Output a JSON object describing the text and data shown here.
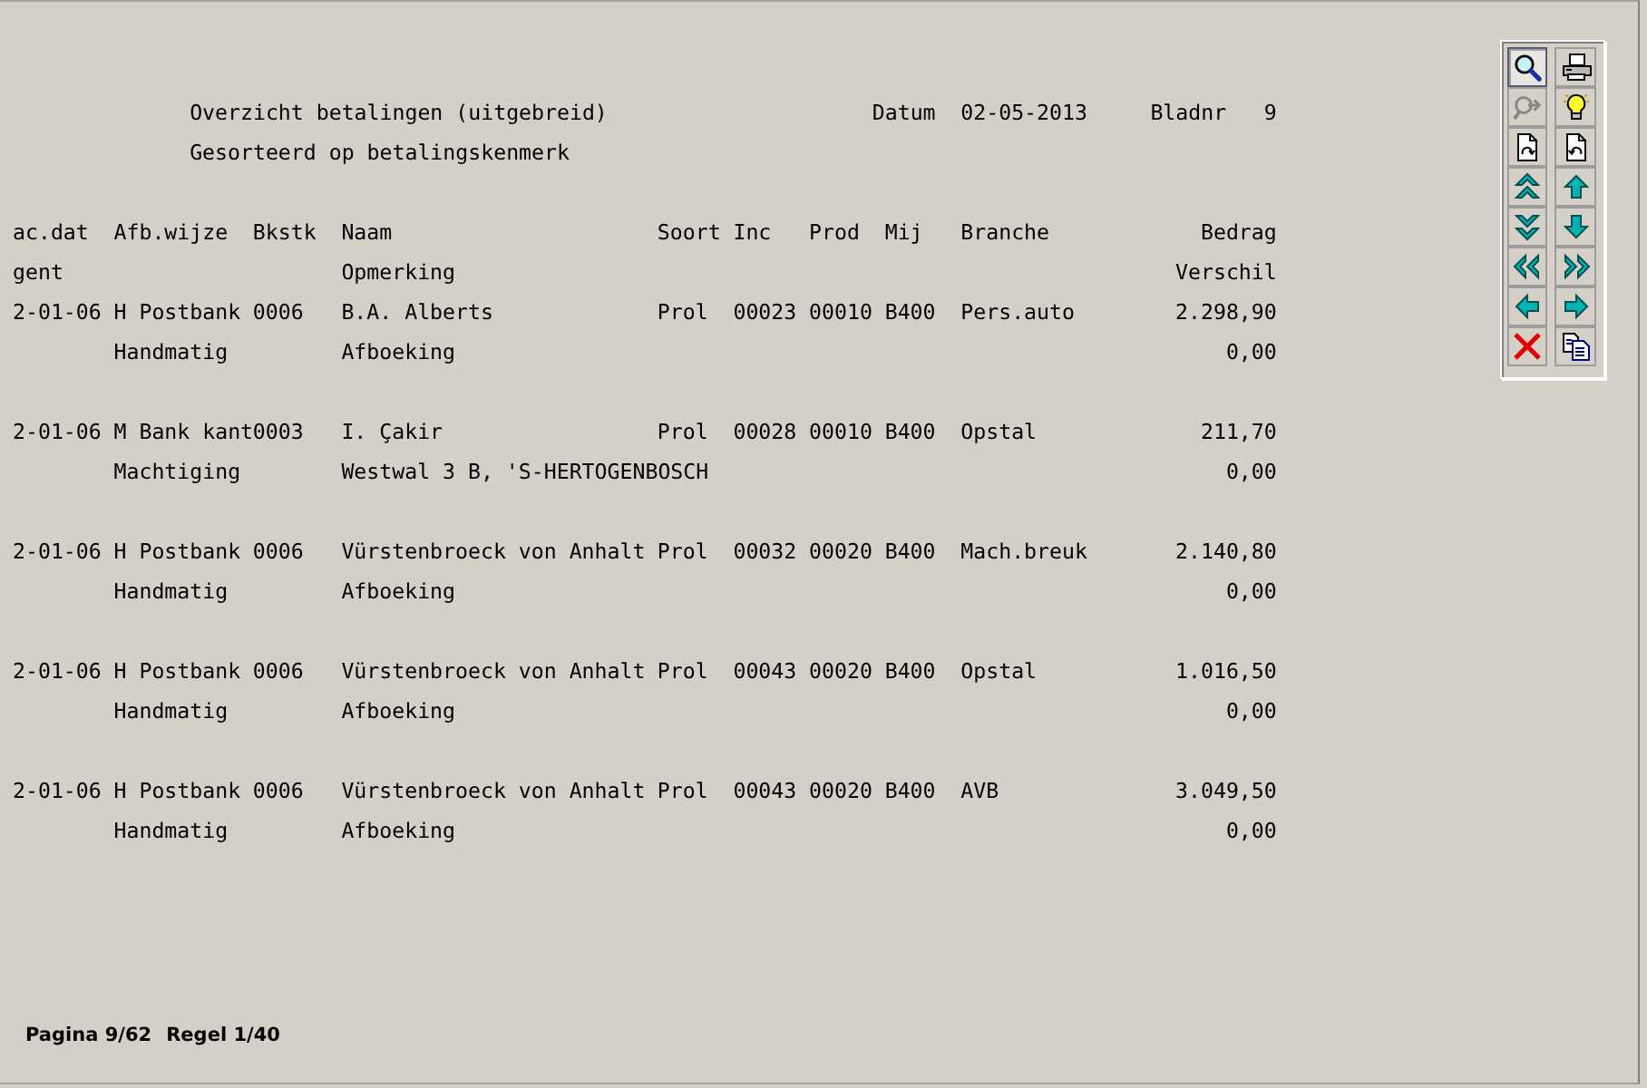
{
  "report": {
    "title": "Overzicht betalingen (uitgebreid)",
    "subtitle": "Gesorteerd op betalingskenmerk",
    "date_label": "Datum",
    "date": "02-05-2013",
    "page_label": "Bladnr",
    "page": "9"
  },
  "table": {
    "columns": [
      {
        "label": "ac.dat",
        "sub_label": "gent"
      },
      {
        "label": "Afb.wijze"
      },
      {
        "label": "Bkstk"
      },
      {
        "label": "Naam",
        "sub_label": "Opmerking"
      },
      {
        "label": "Soort"
      },
      {
        "label": "Inc"
      },
      {
        "label": "Prod"
      },
      {
        "label": "Mij"
      },
      {
        "label": "Branche"
      },
      {
        "label": "Bedrag",
        "sub_label": "Verschil"
      }
    ],
    "rows": [
      {
        "cells": [
          "2-01-06",
          "H Postbank",
          "0006",
          "B.A. Alberts",
          "Prol",
          "00023",
          "00010",
          "B400",
          "Pers.auto",
          "2.298,90"
        ],
        "detail": {
          "method": "Handmatig",
          "remark": "Afboeking",
          "difference": "0,00"
        }
      },
      {
        "cells": [
          "2-01-06",
          "M Bank kant",
          "0003",
          "I. Çakir",
          "Prol",
          "00028",
          "00010",
          "B400",
          "Opstal",
          "211,70"
        ],
        "detail": {
          "method": "Machtiging",
          "remark": "Westwal 3 B, 'S-HERTOGENBOSCH",
          "difference": "0,00"
        }
      },
      {
        "cells": [
          "2-01-06",
          "H Postbank",
          "0006",
          "Vürstenbroeck von Anhalt",
          "Prol",
          "00032",
          "00020",
          "B400",
          "Mach.breuk",
          "2.140,80"
        ],
        "detail": {
          "method": "Handmatig",
          "remark": "Afboeking",
          "difference": "0,00"
        }
      },
      {
        "cells": [
          "2-01-06",
          "H Postbank",
          "0006",
          "Vürstenbroeck von Anhalt",
          "Prol",
          "00043",
          "00020",
          "B400",
          "Opstal",
          "1.016,50"
        ],
        "detail": {
          "method": "Handmatig",
          "remark": "Afboeking",
          "difference": "0,00"
        }
      },
      {
        "cells": [
          "2-01-06",
          "H Postbank",
          "0006",
          "Vürstenbroeck von Anhalt",
          "Prol",
          "00043",
          "00020",
          "B400",
          "AVB",
          "3.049,50"
        ],
        "detail": {
          "method": "Handmatig",
          "remark": "Afboeking",
          "difference": "0,00"
        }
      }
    ]
  },
  "toolbar": {
    "buttons": [
      {
        "kind": "zoom",
        "pressed": true,
        "disabled": false
      },
      {
        "kind": "print",
        "pressed": false,
        "disabled": false
      },
      {
        "kind": "findnext",
        "pressed": false,
        "disabled": true
      },
      {
        "kind": "hint",
        "pressed": false,
        "disabled": false
      },
      {
        "kind": "pageforward",
        "pressed": false,
        "disabled": false
      },
      {
        "kind": "pageback",
        "pressed": false,
        "disabled": false
      },
      {
        "kind": "top",
        "pressed": false,
        "disabled": false
      },
      {
        "kind": "up",
        "pressed": false,
        "disabled": false
      },
      {
        "kind": "bottom",
        "pressed": false,
        "disabled": false
      },
      {
        "kind": "down",
        "pressed": false,
        "disabled": false
      },
      {
        "kind": "rewind",
        "pressed": false,
        "disabled": false
      },
      {
        "kind": "forward",
        "pressed": false,
        "disabled": false
      },
      {
        "kind": "left",
        "pressed": false,
        "disabled": false
      },
      {
        "kind": "right",
        "pressed": false,
        "disabled": false
      },
      {
        "kind": "close",
        "pressed": false,
        "disabled": false
      },
      {
        "kind": "copy",
        "pressed": false,
        "disabled": false
      }
    ]
  },
  "status_bar": {
    "page": "Pagina 9/62",
    "line": "Regel 1/40"
  }
}
